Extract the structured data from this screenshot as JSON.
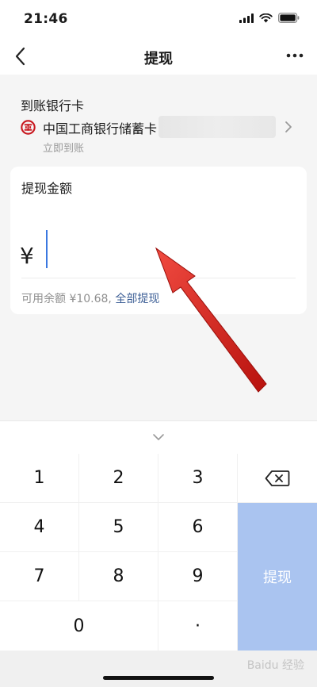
{
  "status": {
    "time": "21:46"
  },
  "nav": {
    "title": "提现",
    "back_icon": "chevron-left-icon",
    "more_icon": "more-icon"
  },
  "bank": {
    "label": "到账银行卡",
    "name": "中国工商银行储蓄卡",
    "subtitle": "立即到账",
    "icon": "icbc-logo-icon"
  },
  "amount": {
    "title": "提现金额",
    "currency": "¥",
    "balance_text": "可用余额 ¥10.68,",
    "withdraw_all": "全部提现"
  },
  "keypad": {
    "k1": "1",
    "k2": "2",
    "k3": "3",
    "k4": "4",
    "k5": "5",
    "k6": "6",
    "k7": "7",
    "k8": "8",
    "k9": "9",
    "k0": "0",
    "dot": "·",
    "submit": "提现",
    "delete_icon": "backspace-icon"
  },
  "watermark": "Baidu 经验",
  "colors": {
    "accent": "#3b78e0",
    "link": "#3d5f96",
    "submit_bg": "#aac4f0",
    "annotation_arrow": "#e0231c"
  }
}
